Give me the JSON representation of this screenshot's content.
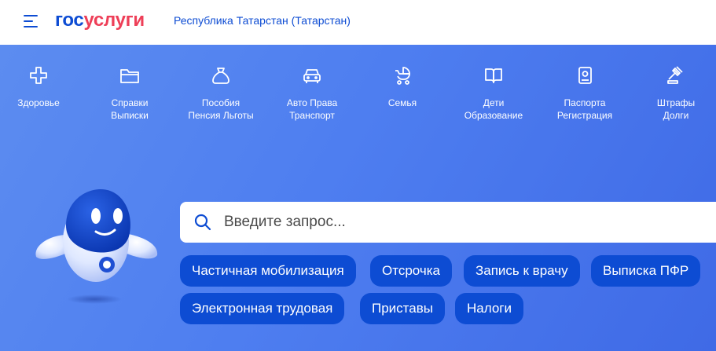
{
  "header": {
    "logo_part1": "гос",
    "logo_part2": "услуги",
    "region": "Республика Татарстан (Татарстан)"
  },
  "categories": [
    {
      "label": "Здоровье",
      "icon": "health-cross-icon"
    },
    {
      "label": "Справки\nВыписки",
      "icon": "folder-icon"
    },
    {
      "label": "Пособия\nПенсия Льготы",
      "icon": "money-bag-icon"
    },
    {
      "label": "Авто Права\nТранспорт",
      "icon": "car-icon"
    },
    {
      "label": "Семья",
      "icon": "stroller-icon"
    },
    {
      "label": "Дети\nОбразование",
      "icon": "book-icon"
    },
    {
      "label": "Паспорта\nРегистрация",
      "icon": "passport-icon"
    },
    {
      "label": "Штрафы\nДолги",
      "icon": "gavel-icon"
    }
  ],
  "search": {
    "placeholder": "Введите запрос..."
  },
  "chips": [
    "Частичная мобилизация",
    "Отсрочка",
    "Запись к врачу",
    "Выписка ПФР",
    "Электронная трудовая",
    "Приставы",
    "Налоги"
  ],
  "colors": {
    "brand_blue": "#0d4cd3",
    "brand_red": "#ee3f58",
    "hero_bg": "#4e7ef0"
  }
}
